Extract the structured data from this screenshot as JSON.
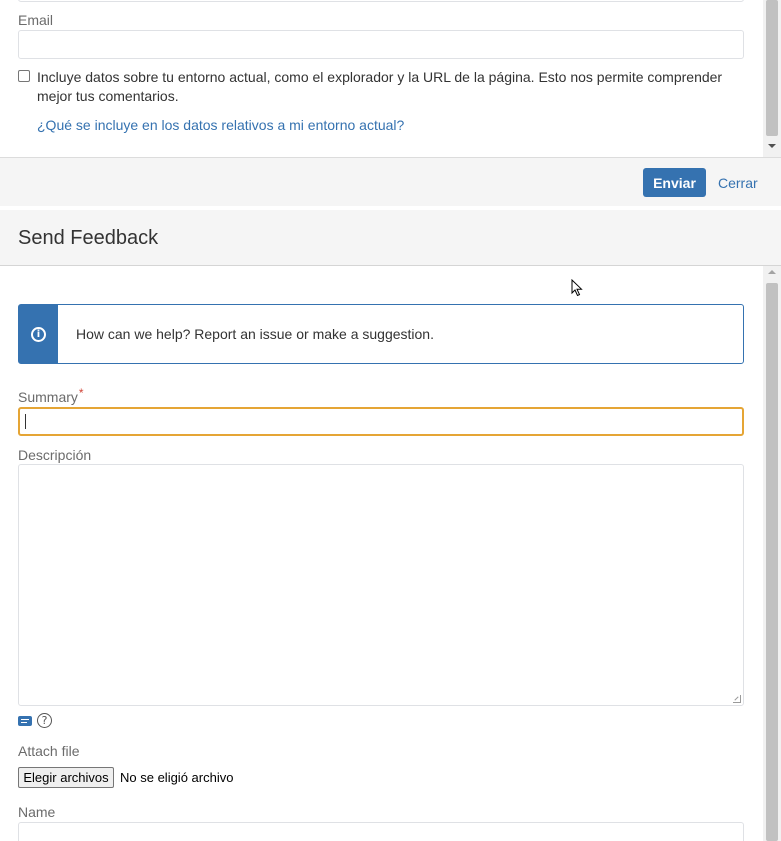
{
  "top_dialog": {
    "email_label": "Email",
    "email_value": "",
    "env_checkbox_checked": false,
    "env_text": "Incluye datos sobre tu entorno actual, como el explorador y la URL de la página. Esto nos permite comprender mejor tus comentarios.",
    "env_link": "¿Qué se incluye en los datos relativos a mi entorno actual?",
    "submit_label": "Enviar",
    "close_label": "Cerrar"
  },
  "feedback_dialog": {
    "title": "Send Feedback",
    "info_message": "How can we help? Report an issue or make a suggestion.",
    "info_icon": "info-icon",
    "summary_label": "Summary",
    "summary_required_marker": "*",
    "summary_value": "",
    "description_label": "Descripción",
    "description_value": "",
    "attach_label": "Attach file",
    "file_button_label": "Elegir archivos",
    "file_status": "No se eligió archivo",
    "name_label": "Name",
    "name_value": ""
  },
  "colors": {
    "primary": "#3572b0",
    "focus_border": "#e5a535",
    "required": "#d04437",
    "header_bg": "#f5f5f5"
  }
}
